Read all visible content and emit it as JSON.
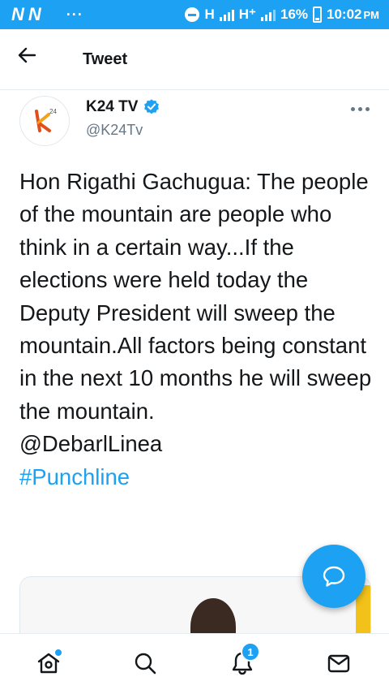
{
  "status_bar": {
    "carrier_icons": [
      "N",
      "N"
    ],
    "overflow": "···",
    "network1": "H",
    "network2": "H⁺",
    "battery": "16%",
    "time": "10:02",
    "ampm": "PM"
  },
  "header": {
    "title": "Tweet"
  },
  "tweet": {
    "author": {
      "name": "K24 TV",
      "handle": "@K24Tv",
      "verified": true,
      "avatar_text": "24"
    },
    "text": "Hon Rigathi Gachugua: The people of the mountain are people who think in a certain way...If the elections were held today the Deputy President will sweep the mountain.All factors being constant in the next 10 months he will sweep the mountain.",
    "mention": "@DebarlLinea",
    "hashtag": "#Punchline"
  },
  "bottom_nav": {
    "notification_count": "1",
    "items": [
      "home-icon",
      "search-icon",
      "notifications-icon",
      "messages-icon"
    ]
  },
  "colors": {
    "accent": "#1da1f2",
    "text": "#14171a",
    "secondary": "#657786"
  }
}
